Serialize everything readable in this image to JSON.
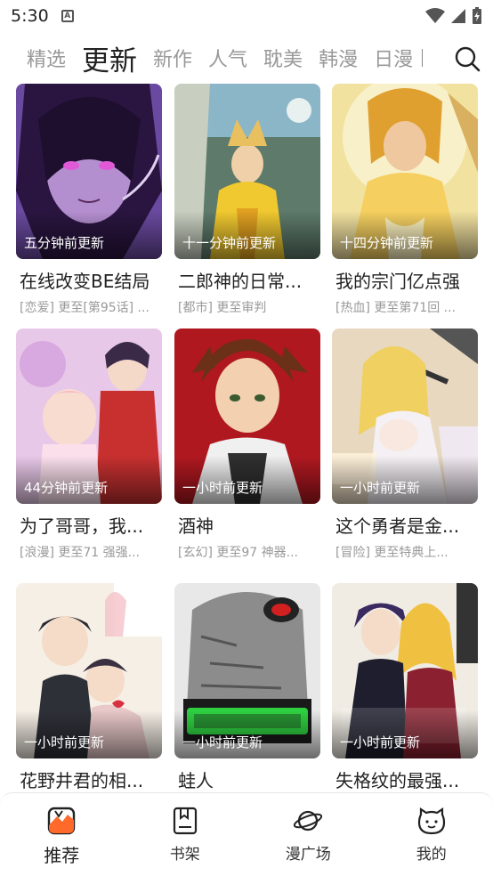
{
  "status_bar": {
    "time": "5:30",
    "notification_glyph": "A"
  },
  "tabs": [
    "精选",
    "更新",
    "新作",
    "人气",
    "耽美",
    "韩漫",
    "日漫"
  ],
  "active_tab": 1,
  "comics": [
    {
      "update": "五分钟前更新",
      "title": "在线改变BE结局",
      "sub": "[恋爱] 更至[第95话] ..."
    },
    {
      "update": "十一分钟前更新",
      "title": "二郎神的日常...",
      "sub": "[都市] 更至审判"
    },
    {
      "update": "十四分钟前更新",
      "title": "我的宗门亿点强",
      "sub": "[热血] 更至第71回 ..."
    },
    {
      "update": "44分钟前更新",
      "title": "为了哥哥，我...",
      "sub": "[浪漫] 更至71 强强..."
    },
    {
      "update": "一小时前更新",
      "title": "酒神",
      "sub": "[玄幻] 更至97 神器..."
    },
    {
      "update": "一小时前更新",
      "title": "这个勇者是金...",
      "sub": "[冒险] 更至特典上..."
    },
    {
      "update": "一小时前更新",
      "title": "花野井君的相...",
      "sub": ""
    },
    {
      "update": "一小时前更新",
      "title": "蛙人",
      "sub": ""
    },
    {
      "update": "一小时前更新",
      "title": "失格纹的最强...",
      "sub": ""
    }
  ],
  "bottom_nav": [
    "推荐",
    "书架",
    "漫广场",
    "我的"
  ],
  "colors": {
    "accent": "#ff6a2b",
    "text": "#222222",
    "muted": "#999999"
  }
}
